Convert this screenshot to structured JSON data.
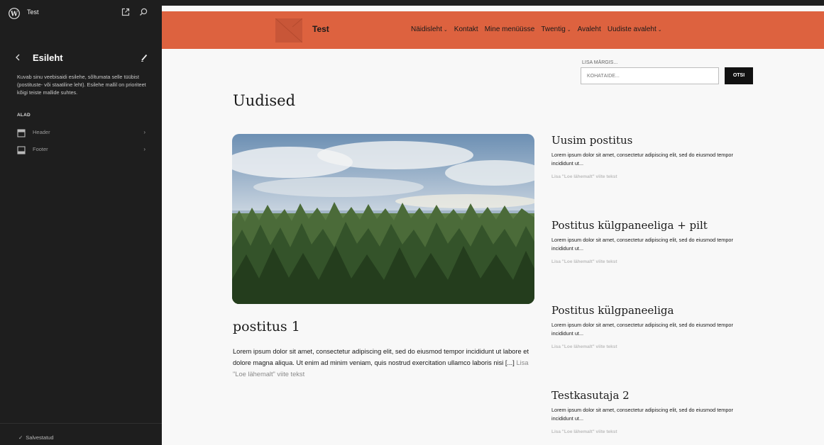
{
  "app": {
    "site_title": "Test"
  },
  "sidebar": {
    "title": "Esileht",
    "description": "Kuvab sinu veebisaidi esilehe, sõltumata selle tüübist (postituste- või staatiline leht). Esilehe mallil on prioriteet kõigi teiste mallide suhtes.",
    "areas_label": "ALAD",
    "areas": [
      {
        "label": "Header",
        "icon": "header-icon"
      },
      {
        "label": "Footer",
        "icon": "footer-icon"
      }
    ],
    "status": "Salvestatud"
  },
  "site": {
    "title": "Test",
    "nav": [
      {
        "label": "Näidisleht",
        "has_submenu": true
      },
      {
        "label": "Kontakt",
        "has_submenu": false
      },
      {
        "label": "Mine menüüsse",
        "has_submenu": false
      },
      {
        "label": "Twentig",
        "has_submenu": true
      },
      {
        "label": "Avaleht",
        "has_submenu": false
      },
      {
        "label": "Uudiste avaleht",
        "has_submenu": true
      }
    ],
    "accent_color": "#dd623f"
  },
  "search": {
    "label": "LISA MÄRGIS...",
    "placeholder": "KOHATÄIDE...",
    "button": "OTSI"
  },
  "page": {
    "title": "Uudised",
    "featured": {
      "title": "postitus 1",
      "excerpt": "Lorem ipsum dolor sit amet, consectetur adipiscing elit, sed do eiusmod tempor incididunt ut labore et dolore magna aliqua. Ut enim ad minim veniam, quis nostrud exercitation ullamco laboris nisi [...]",
      "read_more": "Lisa \"Loe lähemalt\" viite tekst"
    },
    "posts": [
      {
        "title": "Uusim postitus",
        "excerpt": "Lorem ipsum dolor sit amet, consectetur adipiscing elit, sed do eiusmod tempor incididunt ut...",
        "read_more": "Lisa \"Loe lähemalt\" viite tekst"
      },
      {
        "title": "Postitus külgpaneeliga + pilt",
        "excerpt": "Lorem ipsum dolor sit amet, consectetur adipiscing elit, sed do eiusmod tempor incididunt ut...",
        "read_more": "Lisa \"Loe lähemalt\" viite tekst"
      },
      {
        "title": "Postitus külgpaneeliga",
        "excerpt": "Lorem ipsum dolor sit amet, consectetur adipiscing elit, sed do eiusmod tempor incididunt ut...",
        "read_more": "Lisa \"Loe lähemalt\" viite tekst"
      },
      {
        "title": "Testkasutaja 2",
        "excerpt": "Lorem ipsum dolor sit amet, consectetur adipiscing elit, sed do eiusmod tempor incididunt ut...",
        "read_more": "Lisa \"Loe lähemalt\" viite tekst"
      }
    ]
  }
}
